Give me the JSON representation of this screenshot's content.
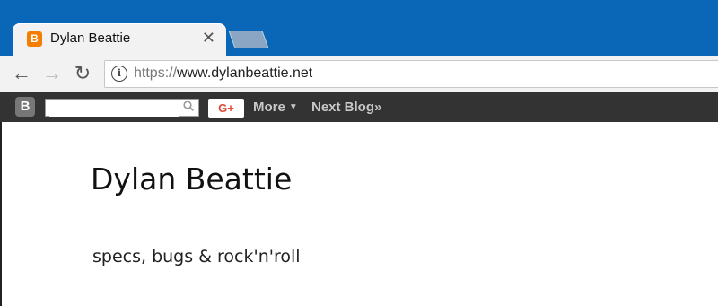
{
  "tab": {
    "title": "Dylan Beattie",
    "favicon": "B",
    "close_icon": "✕"
  },
  "toolbar": {
    "back_icon": "←",
    "forward_icon": "→",
    "reload_icon": "↻",
    "url_scheme": "https://",
    "url_host": "www.dylanbeattie.net"
  },
  "navbar": {
    "logo": "B",
    "search": {
      "value": "",
      "placeholder": ""
    },
    "gplus_label": "G+",
    "more_label": "More",
    "next_blog_label": "Next Blog»"
  },
  "page": {
    "title": "Dylan Beattie",
    "description": "specs, bugs & rock'n'roll"
  },
  "colors": {
    "chrome_frame": "#0a66b7",
    "navbar": "#333333",
    "favicon": "#f57d00"
  }
}
